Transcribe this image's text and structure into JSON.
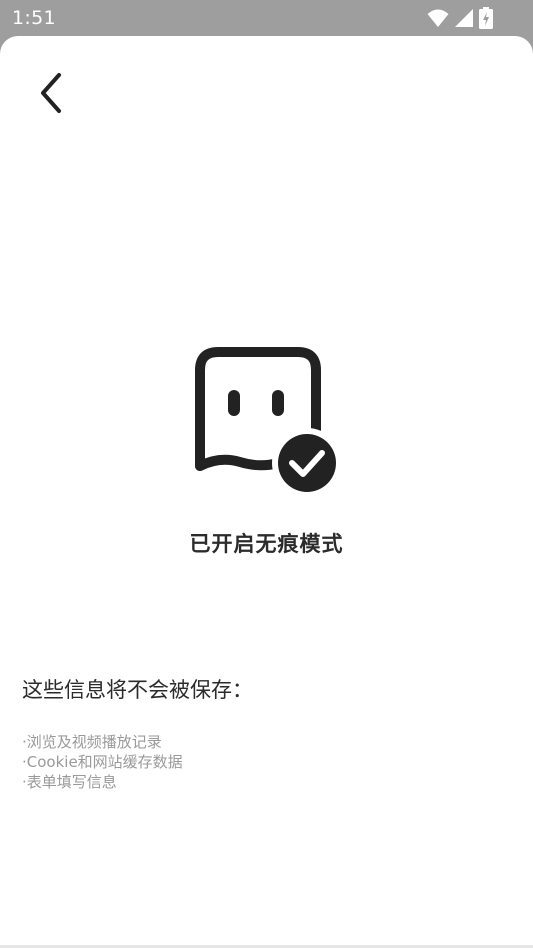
{
  "status_bar": {
    "time": "1:51"
  },
  "page": {
    "title": "已开启无痕模式",
    "info_heading": "这些信息将不会被保存：",
    "info_items": [
      "·浏览及视频播放记录",
      "·Cookie和网站缓存数据",
      "·表单填写信息"
    ]
  },
  "icons": {
    "back": "back-arrow-icon",
    "incognito": "ghost-check-icon",
    "wifi": "wifi-icon",
    "signal": "signal-icon",
    "battery": "battery-charging-icon"
  },
  "colors": {
    "status_bar": "#9e9e9e",
    "background": "#ffffff",
    "title_text": "#2b2b2b",
    "list_text": "#9a9a9a",
    "icon": "#222222"
  }
}
